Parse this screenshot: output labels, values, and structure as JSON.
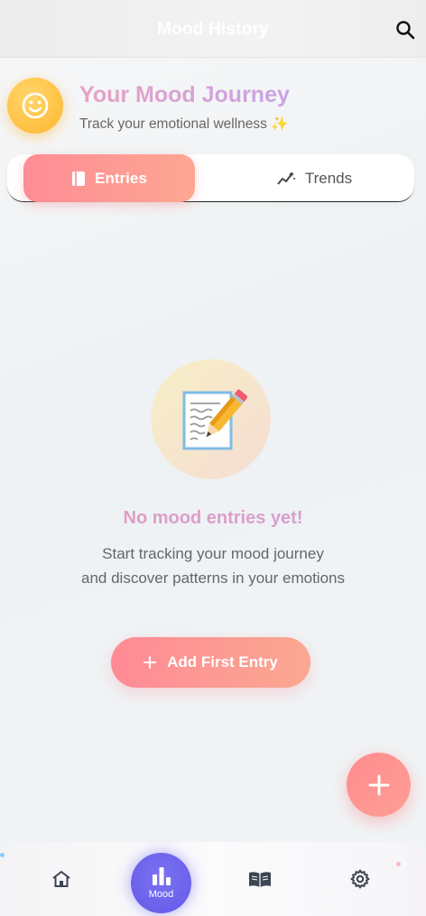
{
  "appbar": {
    "title": "Mood History",
    "search_icon": "search-icon"
  },
  "header": {
    "title": "Your Mood Journey",
    "subtitle": "Track your emotional wellness ✨",
    "avatar_icon": "smiley-icon"
  },
  "tabs": [
    {
      "label": "Entries",
      "icon": "book-icon",
      "active": true
    },
    {
      "label": "Trends",
      "icon": "trend-icon",
      "active": false
    }
  ],
  "empty_state": {
    "emoji": "📝",
    "title": "No mood entries yet!",
    "description_line1": "Start tracking your mood journey",
    "description_line2": "and discover patterns in your emotions",
    "button_label": "Add First Entry"
  },
  "fab": {
    "icon": "plus-icon"
  },
  "bottom_nav": {
    "items": [
      {
        "name": "home",
        "icon": "home-icon"
      },
      {
        "name": "mood",
        "label": "Mood",
        "icon": "bar-chart-icon",
        "active": true
      },
      {
        "name": "journal",
        "icon": "book-open-icon"
      },
      {
        "name": "settings",
        "icon": "gear-icon"
      }
    ]
  },
  "colors": {
    "accent_pink": "#ff8c95",
    "accent_purple": "#6358e8",
    "title_gradient_start": "#e9a1c4",
    "title_gradient_end": "#c9a3e6"
  }
}
